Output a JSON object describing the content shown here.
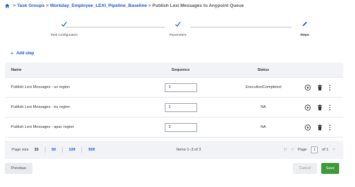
{
  "breadcrumb": {
    "task_groups": "Task Groups",
    "separator": ">",
    "group": "Workday_Employee_LEXI_Pipeline_Baseline",
    "current": "Publish Lexi Messages to Anypoint Queue"
  },
  "stepper": {
    "steps": [
      {
        "label": "Task Configuration",
        "state": "done"
      },
      {
        "label": "Parameters",
        "state": "done"
      },
      {
        "label": "Steps",
        "state": "active"
      }
    ]
  },
  "add_step": {
    "plus": "+",
    "label": "Add step"
  },
  "table": {
    "headers": {
      "name": "Name",
      "sequence": "Sequence",
      "status": "Status"
    },
    "rows": [
      {
        "name": "Publish Lexi Messages - us region",
        "sequence": "0",
        "status": "ExecutionCompleted"
      },
      {
        "name": "Publish Lexi Messages - eu region",
        "sequence": "1",
        "status": "NA"
      },
      {
        "name": "Publish Lexi Messages - apac region",
        "sequence": "2",
        "status": "NA"
      }
    ]
  },
  "pager": {
    "page_size_label": "Page size",
    "sizes": [
      "15",
      "50",
      "100",
      "500"
    ],
    "selected_size": "15",
    "items_text": "Items 1–3 of 3",
    "page_label": "Page",
    "page_value": "1",
    "of_text": "of 1"
  },
  "footer": {
    "previous": "Previous",
    "cancel": "Cancel",
    "save": "Save"
  },
  "colors": {
    "link": "#1a56c8",
    "save": "#3c9a3a"
  }
}
